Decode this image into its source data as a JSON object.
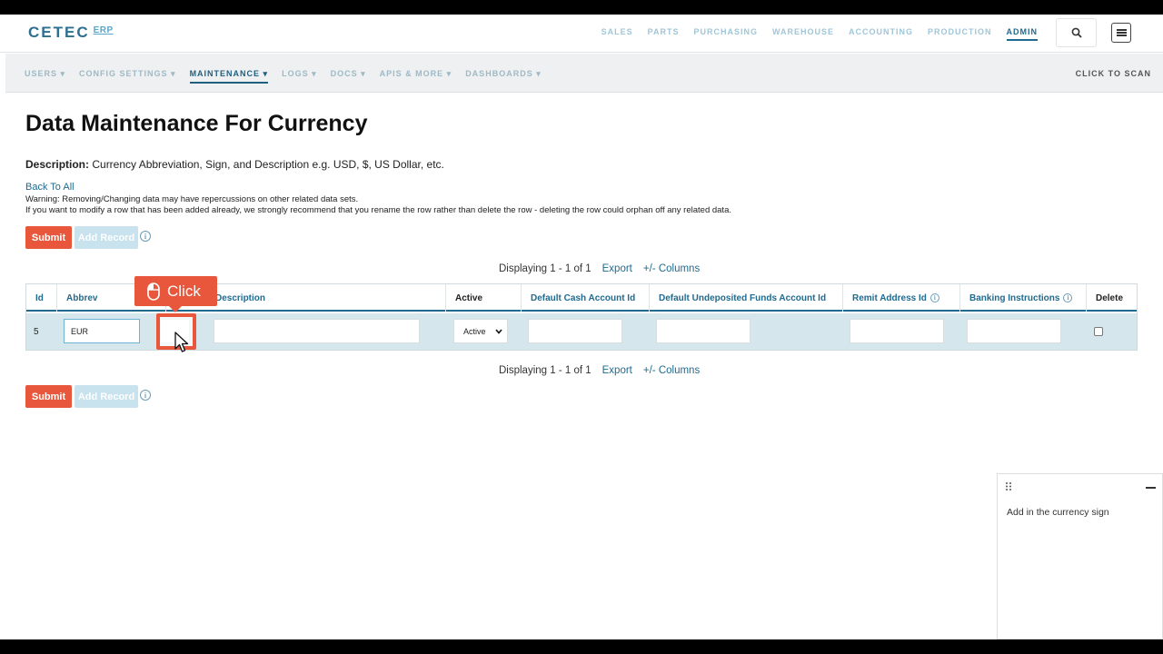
{
  "brand": {
    "name": "CETEC",
    "suffix": "ERP"
  },
  "main_nav": [
    "SALES",
    "PARTS",
    "PURCHASING",
    "WAREHOUSE",
    "ACCOUNTING",
    "PRODUCTION",
    "ADMIN"
  ],
  "main_nav_active": "ADMIN",
  "sub_nav": [
    "USERS ▾",
    "CONFIG SETTINGS ▾",
    "MAINTENANCE ▾",
    "LOGS ▾",
    "DOCS ▾",
    "APIS & MORE ▾",
    "DASHBOARDS ▾"
  ],
  "sub_nav_active": "MAINTENANCE ▾",
  "click_to_scan": "CLICK TO SCAN",
  "page": {
    "title": "Data Maintenance For Currency",
    "description_label": "Description:",
    "description_text": " Currency Abbreviation, Sign, and Description e.g. USD, $, US Dollar, etc.",
    "back_link": "Back To All",
    "warning_1": "Warning: Removing/Changing data may have repercussions on other related data sets.",
    "warning_2": "If you want to modify a row that has been added already, we strongly recommend that you rename the row rather than delete the row - deleting the row could orphan off any related data."
  },
  "buttons": {
    "submit": "Submit",
    "add_record": "Add Record"
  },
  "pager": {
    "text": "Displaying 1 - 1 of 1",
    "export": "Export",
    "columns": "+/- Columns"
  },
  "table": {
    "headers": [
      "Id",
      "Abbrev",
      "Description",
      "Active",
      "Default Cash Account Id",
      "Default Undeposited Funds Account Id",
      "Remit Address Id",
      "Banking Instructions",
      "Delete"
    ],
    "row": {
      "id": "5",
      "abbrev": "EUR",
      "sign": "",
      "description": "",
      "active": "Active",
      "cash_account": "",
      "undeposited": "",
      "remit": "",
      "banking": "",
      "delete": false
    }
  },
  "callout": {
    "label": "Click",
    "icon": "mouse-icon"
  },
  "guide_panel": {
    "text": "Add in the currency sign"
  },
  "colors": {
    "accent": "#e8573b",
    "link": "#1f6a8f",
    "row_bg": "#d6e6ed"
  }
}
